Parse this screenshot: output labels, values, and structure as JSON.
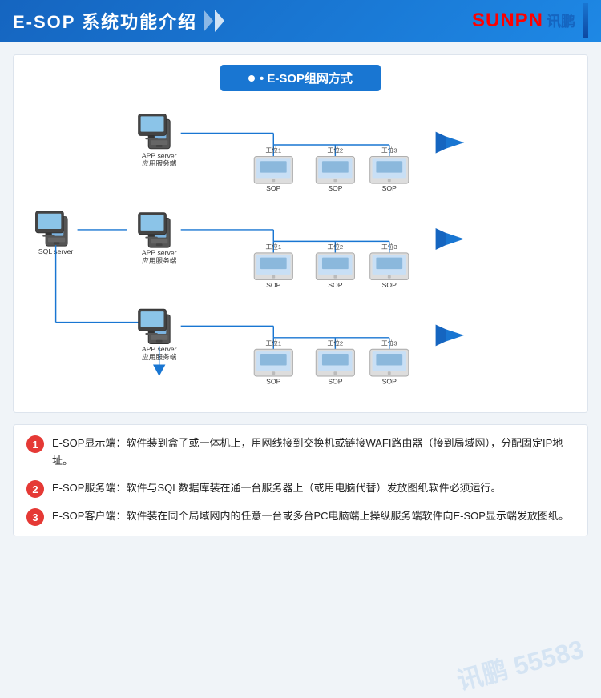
{
  "header": {
    "title": "E-SOP 系统功能介绍",
    "logo_text": "SUNPN",
    "logo_cn": "讯鹏"
  },
  "diagram": {
    "title": "• E-SOP组网方式",
    "rows": [
      {
        "server_label": "APP server\n应用服务端",
        "stations": [
          "工位1",
          "工位2",
          "工位3"
        ],
        "station_labels": [
          "SOP",
          "SOP",
          "SOP"
        ]
      },
      {
        "server_label": "APP server\n应用服务端",
        "stations": [
          "工位1",
          "工位2",
          "工位3"
        ],
        "station_labels": [
          "SOP",
          "SOP",
          "SOP"
        ],
        "sql_label": "SQL server"
      },
      {
        "server_label": "APP server\n应用服务端",
        "stations": [
          "工位1",
          "工位2",
          "工位3"
        ],
        "station_labels": [
          "SOP",
          "SOP",
          "SOP"
        ]
      }
    ]
  },
  "descriptions": [
    {
      "number": "1",
      "text": "E-SOP显示端：软件装到盒子或一体机上，用网线接到交换机或链接WAFI路由器（接到局域网），分配固定IP地址。"
    },
    {
      "number": "2",
      "text": "E-SOP服务端：软件与SQL数据库装在通一台服务器上（或用电脑代替）发放图纸软件必须运行。"
    },
    {
      "number": "3",
      "text": "E-SOP客户端：软件装在同个局域网内的任意一台或多台PC电脑端上操纵服务端软件向E-SOP显示端发放图纸。"
    }
  ],
  "watermark": "讯鹏 55583"
}
